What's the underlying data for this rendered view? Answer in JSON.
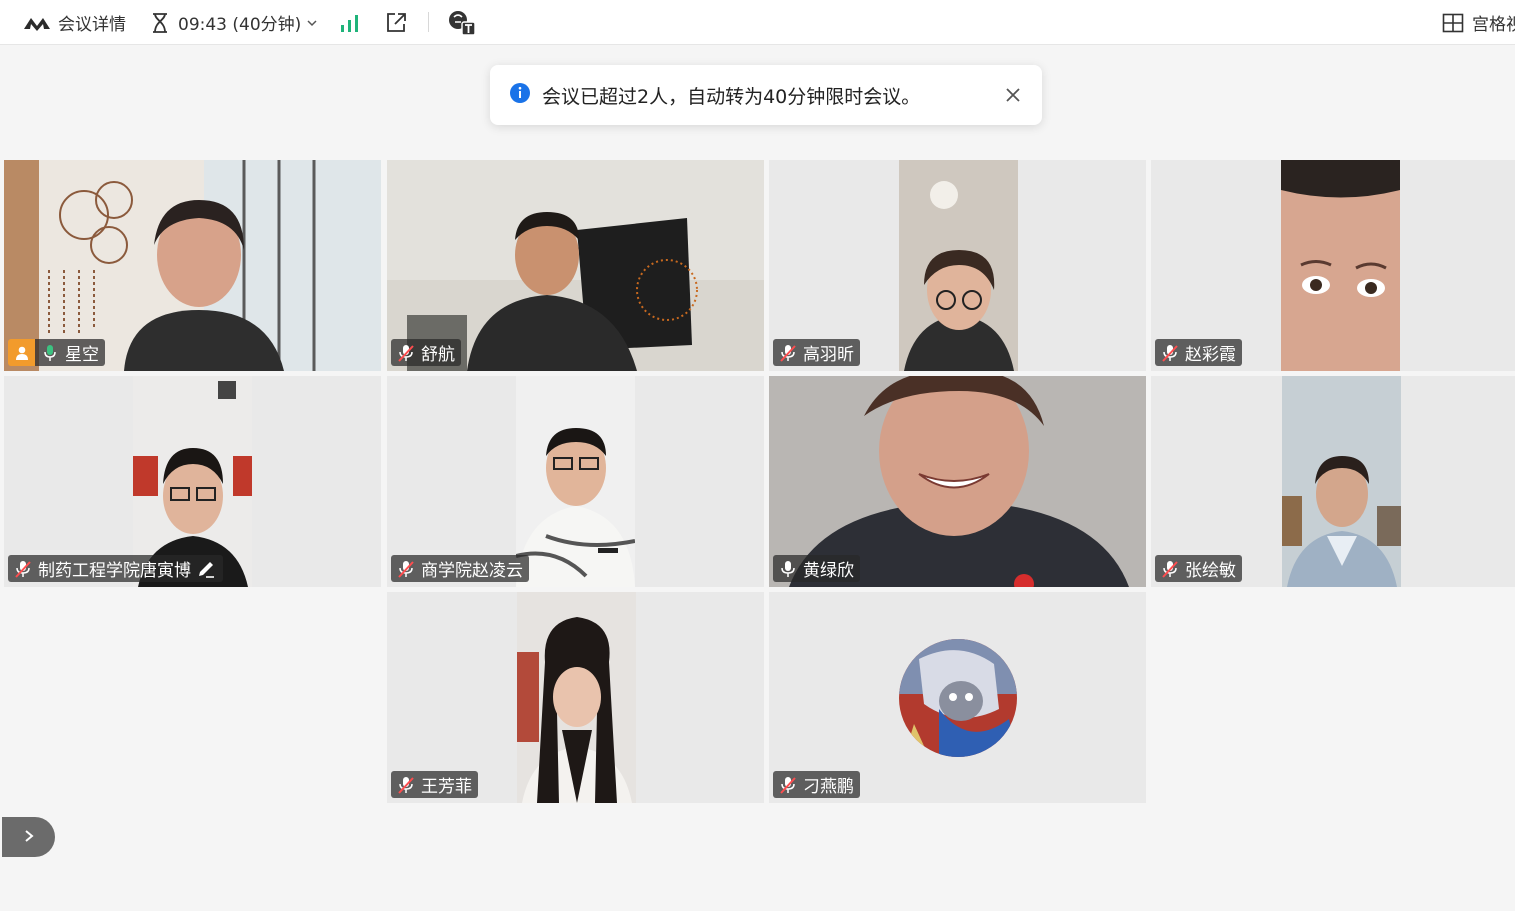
{
  "toolbar": {
    "meeting_details": "会议详情",
    "timer": "09:43 (40分钟)",
    "layout_label": "宫格视",
    "signal_color": "#1fb37a"
  },
  "toast": {
    "message": "会议已超过2人，自动转为40分钟限时会议。",
    "info_color": "#1a73e8"
  },
  "accent": {
    "active_border": "#3cc281",
    "host_badge": "#f29b2c",
    "speaking_mic": "#3cc281"
  },
  "participants": [
    {
      "name": "星空",
      "mic": "on-speaking",
      "host": true,
      "active": true
    },
    {
      "name": "舒航",
      "mic": "muted"
    },
    {
      "name": "高羽昕",
      "mic": "muted"
    },
    {
      "name": "赵彩霞",
      "mic": "muted"
    },
    {
      "name": "制药工程学院唐寅博",
      "mic": "muted",
      "annotating": true
    },
    {
      "name": "商学院赵凌云",
      "mic": "muted"
    },
    {
      "name": "黄绿欣",
      "mic": "on"
    },
    {
      "name": "张绘敏",
      "mic": "muted"
    },
    {
      "name": "王芳菲",
      "mic": "muted"
    },
    {
      "name": "刁燕鹏",
      "mic": "muted",
      "avatar_only": true
    }
  ]
}
